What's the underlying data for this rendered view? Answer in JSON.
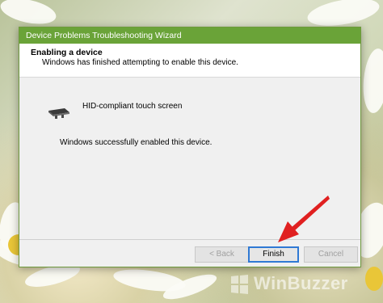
{
  "window": {
    "title": "Device Problems Troubleshooting Wizard"
  },
  "header": {
    "title": "Enabling a device",
    "subtitle": "Windows has finished attempting to enable this device."
  },
  "device": {
    "name": "HID-compliant touch screen",
    "icon": "hid-device-icon"
  },
  "status": {
    "message": "Windows successfully enabled this device."
  },
  "buttons": {
    "back": "< Back",
    "finish": "Finish",
    "cancel": "Cancel"
  },
  "watermark": {
    "text": "WinBuzzer"
  },
  "colors": {
    "titlebar": "#6aa338",
    "focus_border": "#2f79d4",
    "arrow": "#e02020"
  }
}
